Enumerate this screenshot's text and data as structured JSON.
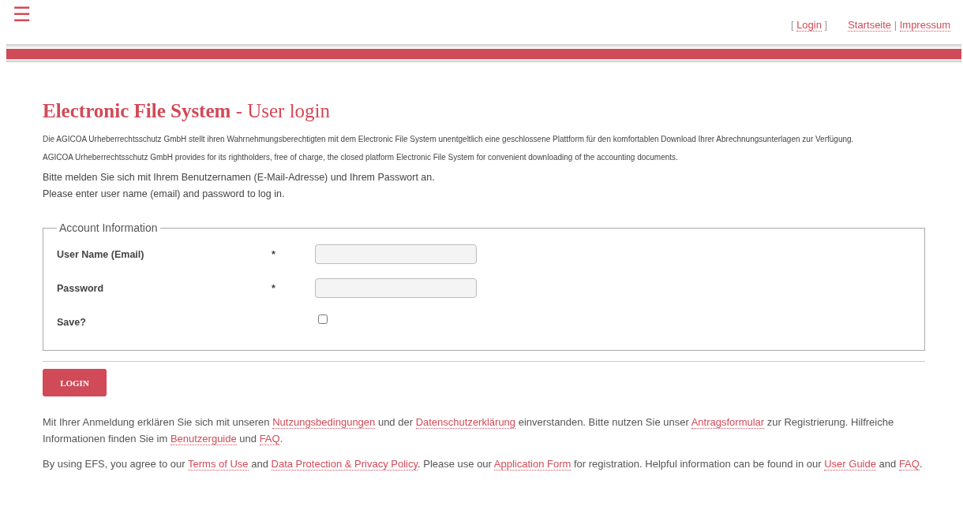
{
  "menu_icon": "☰",
  "top_nav": [
    {
      "text": "[ "
    },
    {
      "text": "Login",
      "link": true
    },
    {
      "text": " ]"
    }
  ],
  "top_links": [
    {
      "text": "Startseite",
      "link": true
    },
    {
      "text": " | "
    },
    {
      "text": "Impressum",
      "link": true
    }
  ],
  "title": {
    "main": "Electronic File System",
    "sub": " - User login"
  },
  "intro": [
    "Die AGICOA Urheberrechtsschutz GmbH stellt ihren Wahrnehmungsberechtigten mit dem Electronic File System unentgeltlich eine geschlossene Plattform für den komfortablen Download Ihrer Abrechnungsunterlagen zur Verfügung.",
    "AGICOA Urheberrechtsschutz GmbH provides for its rightholders, free of charge, the closed platform Electronic File System for convenient downloading of the accounting documents."
  ],
  "instructions": [
    "Bitte melden Sie sich mit Ihrem Benutzernamen (E-Mail-Adresse) und Ihrem Passwort an.",
    "Please enter user name (email) and password to log in."
  ],
  "form": {
    "legend": "Account Information",
    "fields": [
      {
        "label": "User Name (Email)",
        "required": "*",
        "kind": "text"
      },
      {
        "label": "Password",
        "required": "*",
        "kind": "password"
      },
      {
        "label": "Save?",
        "kind": "checkbox",
        "checked": false
      }
    ]
  },
  "login_button": "LOGIN",
  "notes": [
    [
      {
        "text": "Mit Ihrer Anmeldung erklären Sie sich mit unseren "
      },
      {
        "text": "Nutzungsbedingungen",
        "link": true
      },
      {
        "text": " und der "
      },
      {
        "text": "Datenschutzerklärung",
        "link": true
      },
      {
        "text": " einverstanden. Bitte nutzen Sie unser "
      },
      {
        "text": "Antragsformular",
        "link": true
      },
      {
        "text": " zur Registrierung. Hilfreiche Informationen finden Sie im "
      },
      {
        "text": "Benutzerguide",
        "link": true
      },
      {
        "text": " und "
      },
      {
        "text": "FAQ",
        "link": true
      },
      {
        "text": "."
      }
    ],
    [
      {
        "text": "By using EFS, you agree to our "
      },
      {
        "text": "Terms of Use",
        "link": true
      },
      {
        "text": " and "
      },
      {
        "text": "Data Protection & Privacy Policy",
        "link": true
      },
      {
        "text": ". Please use our "
      },
      {
        "text": "Application Form",
        "link": true
      },
      {
        "text": " for registration. Helpful information can be found in our "
      },
      {
        "text": "User Guide",
        "link": true
      },
      {
        "text": " and "
      },
      {
        "text": "FAQ",
        "link": true
      },
      {
        "text": "."
      }
    ]
  ]
}
